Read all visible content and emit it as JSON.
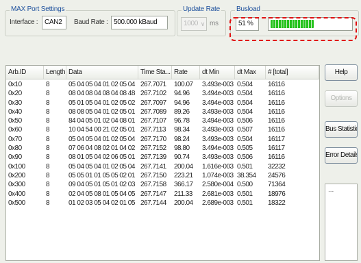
{
  "max_port": {
    "title": "MAX Port Settings",
    "interface_label": "Interface :",
    "interface_value": "CAN2",
    "baud_label": "Baud Rate :",
    "baud_value": "500.000 kBaud"
  },
  "update_rate": {
    "title": "Update Rate",
    "value": "1000",
    "unit": "ms"
  },
  "busload": {
    "title": "Busload",
    "percent_text": "51 %",
    "fraction": 0.51,
    "fill_color": "#25c21d",
    "highlight_color": "#e10f10"
  },
  "table": {
    "columns": [
      "Arb.ID",
      "Length",
      "Data",
      "Time Sta...",
      "Rate",
      "dt Min",
      "dt Max",
      "# [total]"
    ],
    "rows": [
      [
        "0x10",
        "8",
        "05 04 05 04 01 02 05 04",
        "267.7071",
        "100.07",
        "3.493e-003",
        "0.504",
        "16116"
      ],
      [
        "0x20",
        "8",
        "08 04 08 04 08 04 08 48",
        "267.7102",
        "94.96",
        "3.494e-003",
        "0.504",
        "16116"
      ],
      [
        "0x30",
        "8",
        "05 01 05 04 01 02 05 02",
        "267.7097",
        "94.96",
        "3.494e-003",
        "0.504",
        "16116"
      ],
      [
        "0x40",
        "8",
        "08 08 05 04 01 02 05 01",
        "267.7089",
        "89.26",
        "3.493e-003",
        "0.504",
        "16116"
      ],
      [
        "0x50",
        "8",
        "84 04 05 01 02 04 08 01",
        "267.7107",
        "96.78",
        "3.494e-003",
        "0.506",
        "16116"
      ],
      [
        "0x60",
        "8",
        "10 04 54 00 21 02 05 01",
        "267.7113",
        "98.34",
        "3.493e-003",
        "0.507",
        "16116"
      ],
      [
        "0x70",
        "8",
        "05 04 05 04 01 02 05 04",
        "267.7170",
        "98.24",
        "3.493e-003",
        "0.504",
        "16117"
      ],
      [
        "0x80",
        "8",
        "07 06 04 08 02 01 04 02",
        "267.7152",
        "98.80",
        "3.494e-003",
        "0.505",
        "16117"
      ],
      [
        "0x90",
        "8",
        "08 01 05 04 02 06 05 01",
        "267.7139",
        "90.74",
        "3.493e-003",
        "0.506",
        "16116"
      ],
      [
        "0x100",
        "8",
        "05 04 05 04 01 02 05 04",
        "267.7141",
        "200.04",
        "1.616e-003",
        "0.501",
        "32232"
      ],
      [
        "0x200",
        "8",
        "05 05 01 01 05 05 02 01",
        "267.7150",
        "223.21",
        "1.074e-003",
        "38.354",
        "24576"
      ],
      [
        "0x300",
        "8",
        "09 04 05 01 05 01 02 03",
        "267.7158",
        "366.17",
        "2.580e-004",
        "0.500",
        "71364"
      ],
      [
        "0x400",
        "8",
        "02 04 05 08 01 05 04 05",
        "267.7147",
        "211.33",
        "2.681e-003",
        "0.501",
        "18976"
      ],
      [
        "0x500",
        "8",
        "01 02 03 05 04 02 01 05",
        "267.7144",
        "200.04",
        "2.689e-003",
        "0.501",
        "18322"
      ]
    ]
  },
  "buttons": {
    "help": "Help",
    "options": "Options",
    "bus_statistics": "Bus Statistics",
    "error_details": "Error Details"
  },
  "lower_panel_text": "..."
}
